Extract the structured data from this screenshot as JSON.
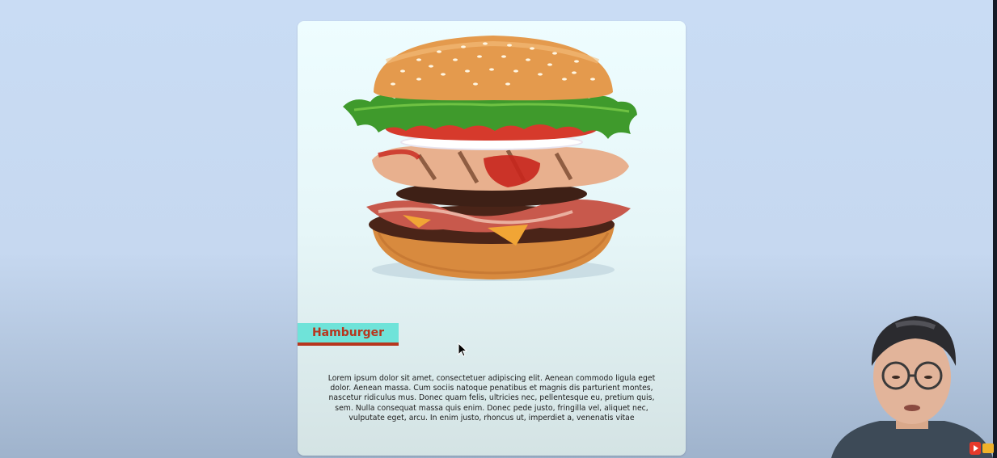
{
  "card": {
    "title": "Hamburger",
    "description": "Lorem ipsum dolor sit amet, consectetuer adipiscing elit. Aenean commodo ligula eget dolor. Aenean massa. Cum sociis natoque penatibus et magnis dis parturient montes, nascetur ridiculus mus. Donec quam felis, ultricies nec, pellentesque eu, pretium quis, sem. Nulla consequat massa quis enim. Donec pede justo, fringilla vel, aliquet nec, vulputate eget, arcu. In enim justo, rhoncus ut, imperdiet a, venenatis vitae",
    "accent_color": "#6fe3d9",
    "title_color": "#b7361e"
  },
  "icons": {
    "burger_image": "hamburger-photo",
    "cursor": "mouse-pointer-icon",
    "webcam": "presenter-webcam",
    "badge": "youtube-icon"
  }
}
